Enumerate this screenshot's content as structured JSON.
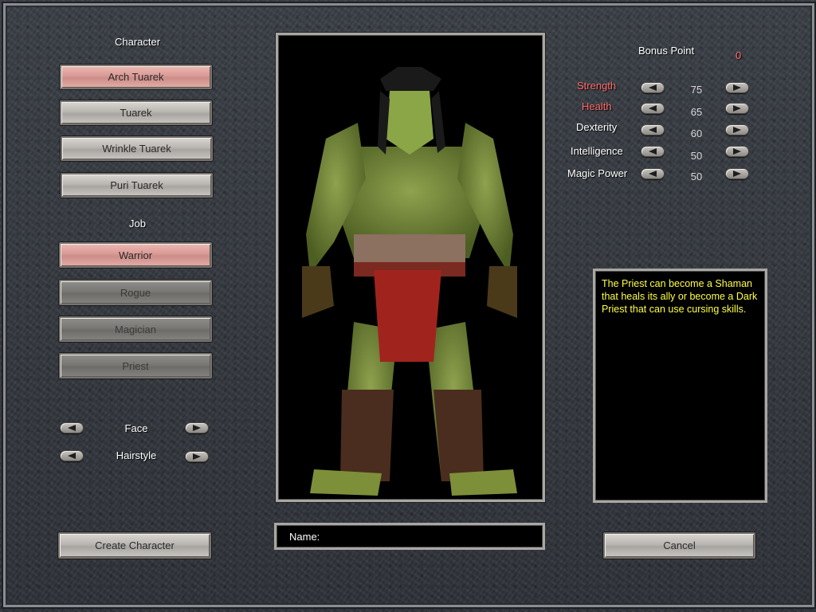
{
  "character": {
    "heading": "Character",
    "options": [
      "Arch Tuarek",
      "Tuarek",
      "Wrinkle Tuarek",
      "Puri Tuarek"
    ]
  },
  "job": {
    "heading": "Job",
    "options": [
      "Warrior",
      "Rogue",
      "Magician",
      "Priest"
    ]
  },
  "appearance": {
    "face_label": "Face",
    "hairstyle_label": "Hairstyle"
  },
  "stats": {
    "bonus_label": "Bonus Point",
    "bonus_value": "0",
    "rows": [
      {
        "label": "Strength",
        "value": "75"
      },
      {
        "label": "Health",
        "value": "65"
      },
      {
        "label": "Dexterity",
        "value": "60"
      },
      {
        "label": "Intelligence",
        "value": "50"
      },
      {
        "label": "Magic Power",
        "value": "50"
      }
    ]
  },
  "description": "The Priest can become a Shaman that heals its ally or become a Dark Priest that can use cursing skills.",
  "name_field": {
    "label": "Name:",
    "value": ""
  },
  "buttons": {
    "create": "Create Character",
    "cancel": "Cancel"
  },
  "colors": {
    "highlight_stat": "#ff6b6b",
    "bonus_value": "#ff6b6b",
    "description_text": "#ffff44",
    "selected_button": "#d89a95"
  },
  "icons": [
    "arrow-left-icon",
    "arrow-right-icon"
  ]
}
